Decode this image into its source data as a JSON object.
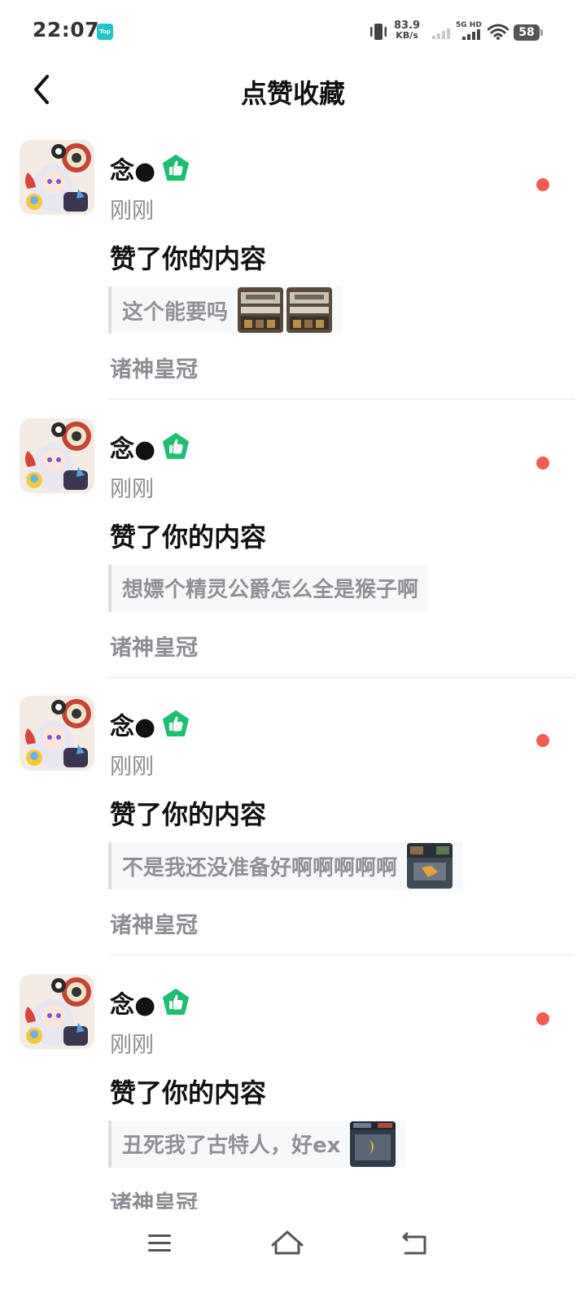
{
  "status_bar": {
    "time": "22:07",
    "app_badge": "Top",
    "net_speed_value": "83.9",
    "net_speed_unit": "KB/s",
    "network_label": "5G HD",
    "battery": "58"
  },
  "header": {
    "title": "点赞收藏",
    "back_icon": "chevron-left-icon"
  },
  "notifications": [
    {
      "user_name": "念●",
      "badge_icon": "thumbs-up-pentagon-icon",
      "time": "刚刚",
      "action": "赞了你的内容",
      "quote": "这个能要吗",
      "thumbnail_count": 2,
      "game": "诸神皇冠",
      "unread": true
    },
    {
      "user_name": "念●",
      "badge_icon": "thumbs-up-pentagon-icon",
      "time": "刚刚",
      "action": "赞了你的内容",
      "quote": "想嫖个精灵公爵怎么全是猴子啊",
      "thumbnail_count": 0,
      "game": "诸神皇冠",
      "unread": true
    },
    {
      "user_name": "念●",
      "badge_icon": "thumbs-up-pentagon-icon",
      "time": "刚刚",
      "action": "赞了你的内容",
      "quote": "不是我还没准备好啊啊啊啊啊",
      "thumbnail_count": 1,
      "game": "诸神皇冠",
      "unread": true
    },
    {
      "user_name": "念●",
      "badge_icon": "thumbs-up-pentagon-icon",
      "time": "刚刚",
      "action": "赞了你的内容",
      "quote": "丑死我了古特人，好ex",
      "thumbnail_count": 1,
      "game": "诸神皇冠",
      "unread": true
    }
  ],
  "nav": {
    "menu_icon": "menu-icon",
    "home_icon": "home-icon",
    "back_icon": "back-arrow-icon"
  },
  "colors": {
    "accent_green": "#1dbf73",
    "unread_dot": "#f25c54",
    "muted_text": "#8a8d93"
  }
}
